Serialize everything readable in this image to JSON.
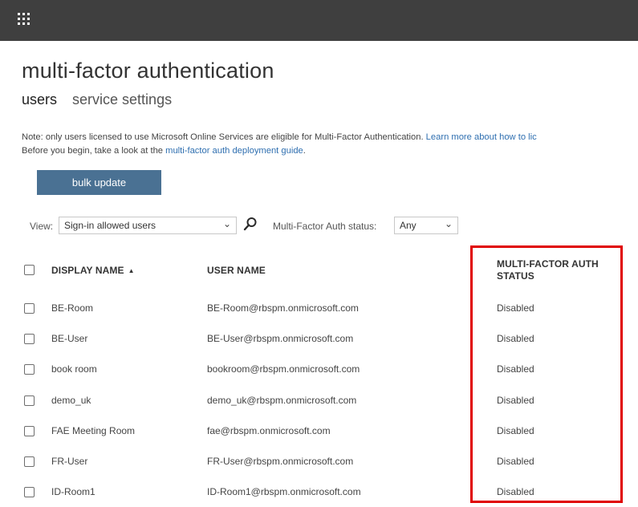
{
  "topbar": {
    "app_launcher_icon": "waffle-icon"
  },
  "page": {
    "title": "multi-factor authentication"
  },
  "tabs": [
    {
      "label": "users",
      "active": true
    },
    {
      "label": "service settings",
      "active": false
    }
  ],
  "note": {
    "line1_text": "Note: only users licensed to use Microsoft Online Services are eligible for Multi-Factor Authentication. ",
    "line1_link": "Learn more about how to lic",
    "line2_text": "Before you begin, take a look at the ",
    "line2_link": "multi-factor auth deployment guide",
    "line2_end": "."
  },
  "toolbar": {
    "bulk_update_label": "bulk update"
  },
  "filters": {
    "view_label": "View:",
    "view_value": "Sign-in allowed users",
    "mfa_status_label": "Multi-Factor Auth status:",
    "mfa_status_value": "Any"
  },
  "table": {
    "columns": {
      "display_name": "DISPLAY NAME",
      "user_name": "USER NAME",
      "mfa_status_line1": "MULTI-FACTOR AUTH",
      "mfa_status_line2": "STATUS"
    },
    "rows": [
      {
        "display_name": "BE-Room",
        "user_name": "BE-Room@rbspm.onmicrosoft.com",
        "status": "Disabled"
      },
      {
        "display_name": "BE-User",
        "user_name": "BE-User@rbspm.onmicrosoft.com",
        "status": "Disabled"
      },
      {
        "display_name": "book room",
        "user_name": "bookroom@rbspm.onmicrosoft.com",
        "status": "Disabled"
      },
      {
        "display_name": "demo_uk",
        "user_name": "demo_uk@rbspm.onmicrosoft.com",
        "status": "Disabled"
      },
      {
        "display_name": "FAE Meeting Room",
        "user_name": "fae@rbspm.onmicrosoft.com",
        "status": "Disabled"
      },
      {
        "display_name": "FR-User",
        "user_name": "FR-User@rbspm.onmicrosoft.com",
        "status": "Disabled"
      },
      {
        "display_name": "ID-Room1",
        "user_name": "ID-Room1@rbspm.onmicrosoft.com",
        "status": "Disabled"
      }
    ]
  },
  "annotation": {
    "highlight_color": "#e00000"
  },
  "colors": {
    "topbar": "#3f3f3f",
    "button": "#4a7193",
    "link": "#2f6fb0"
  }
}
